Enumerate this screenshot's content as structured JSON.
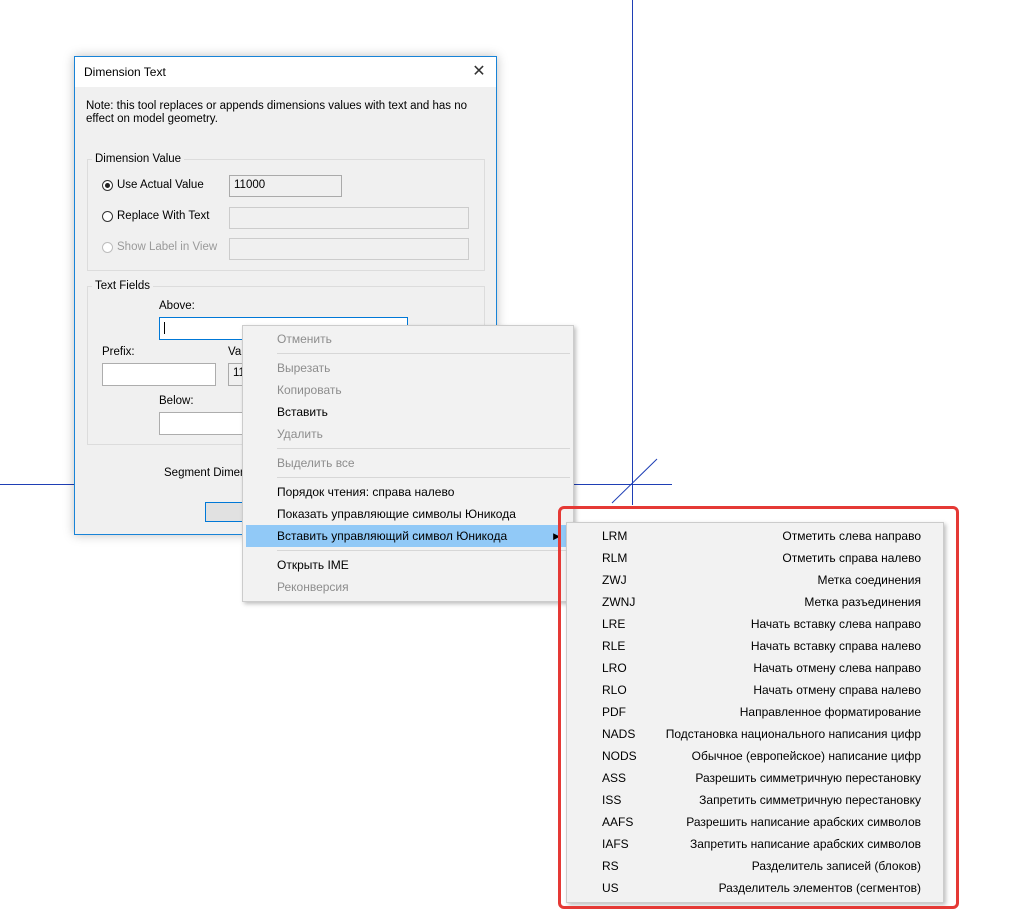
{
  "dialog": {
    "title": "Dimension Text",
    "note": "Note: this tool replaces or appends dimensions values with text and has no effect on model geometry.",
    "dimension_value": {
      "group_title": "Dimension Value",
      "use_actual_label": "Use Actual Value",
      "use_actual_value": "11000",
      "replace_label": "Replace With Text",
      "show_label": "Show Label in View"
    },
    "text_fields": {
      "group_title": "Text Fields",
      "above_label": "Above:",
      "prefix_label": "Prefix:",
      "value_label_partial": "Val",
      "value_partial": "11",
      "below_label": "Below:"
    },
    "segment_label_partial": "Segment Dimens"
  },
  "context_menu": {
    "items": [
      {
        "label": "Отменить",
        "disabled": true
      },
      {
        "label": "Вырезать",
        "disabled": true
      },
      {
        "label": "Копировать",
        "disabled": true
      },
      {
        "label": "Вставить",
        "disabled": false
      },
      {
        "label": "Удалить",
        "disabled": true
      },
      {
        "label": "Выделить все",
        "disabled": true
      },
      {
        "label": "Порядок чтения: справа налево",
        "disabled": false
      },
      {
        "label": "Показать управляющие символы Юникода",
        "disabled": false
      },
      {
        "label": "Вставить управляющий символ Юникода",
        "disabled": false,
        "highlighted": true,
        "submenu_arrow": "▶"
      },
      {
        "label": "Открыть IME",
        "disabled": false
      },
      {
        "label": "Реконверсия",
        "disabled": true
      }
    ]
  },
  "submenu": {
    "items": [
      {
        "code": "LRM",
        "desc": "Отметить слева направо"
      },
      {
        "code": "RLM",
        "desc": "Отметить справа налево"
      },
      {
        "code": "ZWJ",
        "desc": "Метка соединения"
      },
      {
        "code": "ZWNJ",
        "desc": "Метка разъединения"
      },
      {
        "code": "LRE",
        "desc": "Начать вставку слева направо"
      },
      {
        "code": "RLE",
        "desc": "Начать вставку справа налево"
      },
      {
        "code": "LRO",
        "desc": "Начать отмену слева направо"
      },
      {
        "code": "RLO",
        "desc": "Начать отмену справа налево"
      },
      {
        "code": "PDF",
        "desc": "Направленное форматирование"
      },
      {
        "code": "NADS",
        "desc": "Подстановка национального написания цифр"
      },
      {
        "code": "NODS",
        "desc": "Обычное (европейское) написание цифр"
      },
      {
        "code": "ASS",
        "desc": "Разрешить симметричную перестановку"
      },
      {
        "code": "ISS",
        "desc": "Запретить симметричную перестановку"
      },
      {
        "code": "AAFS",
        "desc": "Разрешить написание арабских символов"
      },
      {
        "code": "IAFS",
        "desc": "Запретить написание арабских символов"
      },
      {
        "code": "RS",
        "desc": "Разделитель записей (блоков)"
      },
      {
        "code": "US",
        "desc": "Разделитель элементов (сегментов)"
      }
    ]
  },
  "colors": {
    "highlight": "#91c9f7",
    "annotation_border": "#e53935",
    "canvas_line": "#1f3fb5"
  }
}
